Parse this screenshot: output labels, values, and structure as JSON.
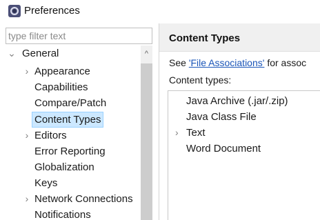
{
  "window": {
    "title": "Preferences",
    "icon": "eclipse-preferences-icon"
  },
  "filter": {
    "placeholder": "type filter text",
    "value": ""
  },
  "tree": {
    "items": [
      {
        "label": "General",
        "expanded": true,
        "twisty": "expanded"
      },
      {
        "label": "Appearance",
        "twisty": "collapsed"
      },
      {
        "label": "Capabilities"
      },
      {
        "label": "Compare/Patch"
      },
      {
        "label": "Content Types",
        "selected": true
      },
      {
        "label": "Editors",
        "twisty": "collapsed"
      },
      {
        "label": "Error Reporting"
      },
      {
        "label": "Globalization"
      },
      {
        "label": "Keys"
      },
      {
        "label": "Network Connections",
        "twisty": "collapsed"
      },
      {
        "label": "Notifications"
      }
    ]
  },
  "page": {
    "title": "Content Types",
    "desc_prefix": "See ",
    "desc_link": "'File Associations'",
    "desc_suffix": " for assoc",
    "content_types_label": "Content types:",
    "content_types": [
      {
        "label": "Java Archive (.jar/.zip)"
      },
      {
        "label": "Java Class File"
      },
      {
        "label": "Text",
        "twisty": "collapsed"
      },
      {
        "label": "Word Document"
      }
    ]
  },
  "colors": {
    "selection_bg": "#cce8ff",
    "selection_border": "#99d1ff",
    "link": "#1a55b8",
    "header_bg": "#f0f0f0"
  }
}
